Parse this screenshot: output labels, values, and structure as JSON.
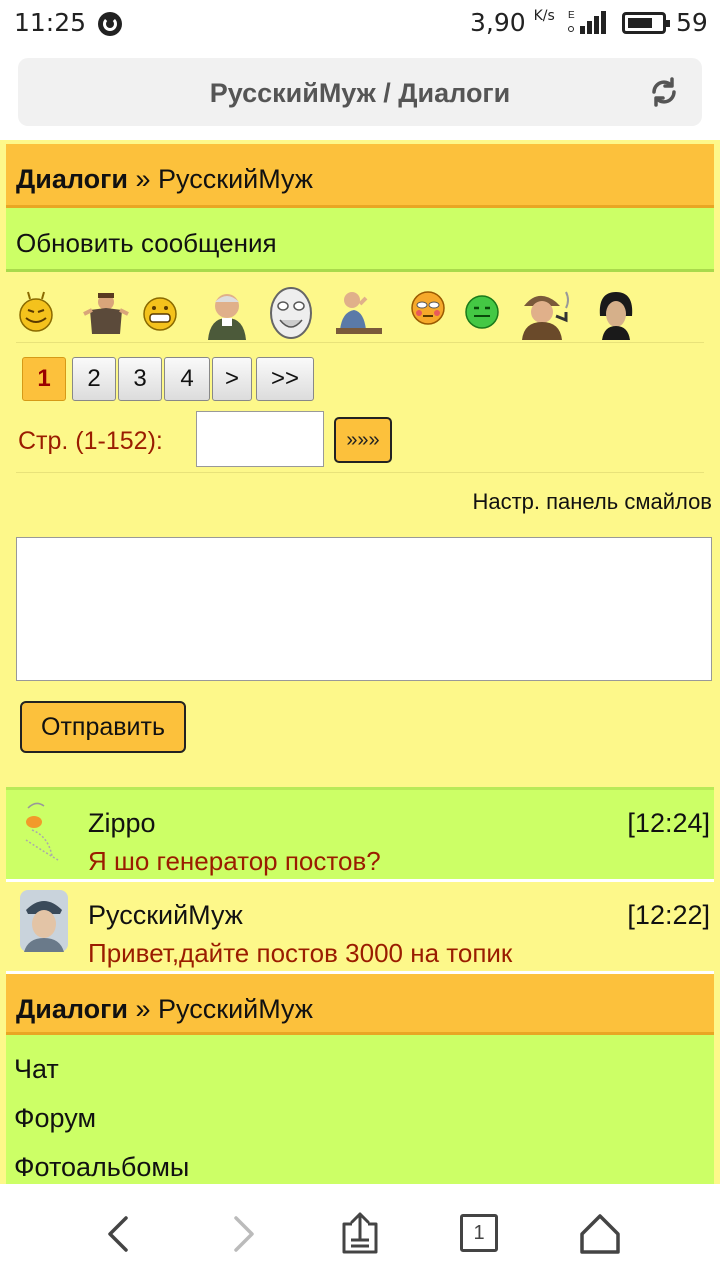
{
  "status": {
    "time": "11:25",
    "speed": "3,90",
    "speed_unit": "K/s",
    "network": "E",
    "battery": "59"
  },
  "browser": {
    "title": "РусскийМуж / Диалоги"
  },
  "header": {
    "section": "Диалоги",
    "separator": "»",
    "topic": "РусскийМуж"
  },
  "refresh": {
    "label": "Обновить сообщения"
  },
  "smiles": [
    "smiley-yellow",
    "smiley-man-shrug",
    "smiley-grin",
    "smiley-old-man",
    "smiley-troll-face",
    "smiley-man-desk",
    "smiley-blush",
    "smiley-green",
    "smiley-detective",
    "smiley-dark-face"
  ],
  "pager": {
    "pages": [
      "1",
      "2",
      "3",
      "4",
      ">",
      ">>"
    ],
    "active": "1",
    "jump_label": "Стр. (1-152):",
    "jump_value": "",
    "go_label": "»»»"
  },
  "composer": {
    "smile_settings": "Настр. панель смайлов",
    "message_value": "",
    "send_label": "Отправить"
  },
  "posts": [
    {
      "author": "Zippo",
      "time": "[12:24]",
      "text": "Я шо генератор постов?"
    },
    {
      "author": "РусскийМуж",
      "time": "[12:22]",
      "text": "Привет,дайте постов 3000 на топик"
    }
  ],
  "footer_header": {
    "section": "Диалоги",
    "separator": "»",
    "topic": "РусскийМуж"
  },
  "menu": [
    {
      "label": "Чат"
    },
    {
      "label": "Форум"
    },
    {
      "label": "Фотоальбомы"
    }
  ],
  "nav": {
    "tabs_count": "1"
  },
  "colors": {
    "page_bg": "#fdf88a",
    "header_bg": "#fcc13c",
    "green_bg": "#ccff66",
    "text_red": "#9a1c00"
  }
}
